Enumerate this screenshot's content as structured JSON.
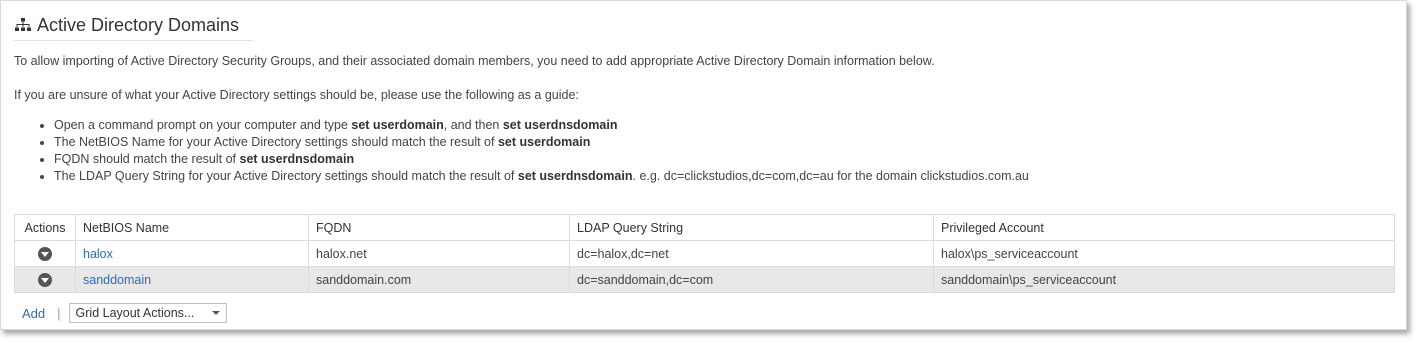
{
  "page": {
    "title": "Active Directory Domains",
    "icon": "sitemap-icon"
  },
  "intro": {
    "line1": "To allow importing of Active Directory Security Groups, and their associated domain members, you need to add appropriate Active Directory Domain information below.",
    "line2": "If you are unsure of what your Active Directory settings should be, please use the following as a guide:"
  },
  "guide": [
    {
      "pre": "Open a command prompt on your computer and type ",
      "b1": "set userdomain",
      "mid": ", and then ",
      "b2": "set userdnsdomain",
      "post": ""
    },
    {
      "pre": "The NetBIOS Name for your Active Directory settings should match the result of ",
      "b1": "set userdomain",
      "mid": "",
      "b2": "",
      "post": ""
    },
    {
      "pre": "FQDN should match the result of ",
      "b1": "set userdnsdomain",
      "mid": "",
      "b2": "",
      "post": ""
    },
    {
      "pre": "The LDAP Query String for your Active Directory settings should match the result of ",
      "b1": "set userdnsdomain",
      "mid": ". e.g. dc=clickstudios,dc=com,dc=au for the domain clickstudios.com.au",
      "b2": "",
      "post": ""
    }
  ],
  "table": {
    "columns": [
      "Actions",
      "NetBIOS Name",
      "FQDN",
      "LDAP Query String",
      "Privileged Account"
    ],
    "rows": [
      {
        "netbios": "halox",
        "fqdn": "halox.net",
        "ldap": "dc=halox,dc=net",
        "account": "halox\\ps_serviceaccount"
      },
      {
        "netbios": "sanddomain",
        "fqdn": "sanddomain.com",
        "ldap": "dc=sanddomain,dc=com",
        "account": "sanddomain\\ps_serviceaccount"
      }
    ]
  },
  "footer": {
    "add_label": "Add",
    "separator": "|",
    "grid_actions_label": "Grid Layout Actions..."
  },
  "colors": {
    "link": "#2a6ebb",
    "alt_row": "#e8e8e8",
    "action_icon": "#555555"
  }
}
